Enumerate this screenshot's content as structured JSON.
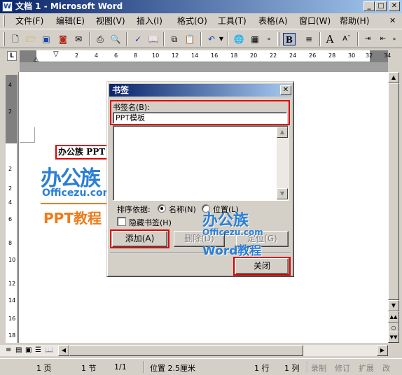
{
  "window": {
    "title": "文档 1 - Microsoft Word",
    "app_icon": "W",
    "controls": [
      "minimize-icon",
      "maximize-icon",
      "close-icon"
    ]
  },
  "menu": [
    "文件(F)",
    "编辑(E)",
    "视图(V)",
    "插入(I)",
    "格式(O)",
    "工具(T)",
    "表格(A)",
    "窗口(W)",
    "帮助(H)"
  ],
  "toolbar": {
    "bold_label": "B",
    "font_grow_label": "A",
    "icons": [
      "new-document-icon",
      "open-icon",
      "save-icon",
      "permission-icon",
      "email-icon",
      "print-icon",
      "print-preview-icon",
      "spelling-icon",
      "research-icon",
      "copy-icon",
      "paste-icon",
      "undo-icon",
      "hyperlink-icon",
      "table-icon",
      "align-icon"
    ]
  },
  "ruler": {
    "corner_label": "L",
    "h_ticks": [
      "2",
      "4",
      "6",
      "8",
      "10",
      "12",
      "14",
      "16",
      "18",
      "20",
      "22",
      "24",
      "26",
      "28",
      "30",
      "32",
      "34"
    ],
    "v_ticks": [
      "4",
      "2",
      "2",
      "2",
      "4",
      "6",
      "8",
      "10",
      "12",
      "14",
      "16",
      "18"
    ]
  },
  "document": {
    "text": "办公族 PPT"
  },
  "dialog": {
    "title": "书签",
    "name_label": "书签名(B):",
    "name_value": "PPT模板",
    "sort_label": "排序依据:",
    "sort_options": [
      {
        "label": "名称(N)",
        "selected": true
      },
      {
        "label": "位置(L)",
        "selected": false
      }
    ],
    "hidden_label": "隐藏书签(H)",
    "hidden_checked": false,
    "buttons": {
      "add": "添加(A)",
      "delete": "删除(D)",
      "goto": "定位(G)",
      "close": "关闭"
    }
  },
  "watermark": {
    "logo_cn": "办公族",
    "logo_en": "Officezu.com",
    "logo_sub": "Word教程",
    "doc_logo_cn": "办公族",
    "doc_logo_en": "Officezu.com",
    "doc_logo_sub": "PPT教程"
  },
  "status": {
    "page": "1 页",
    "section": "1 节",
    "pages": "1/1",
    "position": "位置 2.5厘米",
    "line": "1 行",
    "column": "1 列",
    "rec": "录制",
    "trk": "修订",
    "ext": "扩展",
    "ovr": "改"
  },
  "colors": {
    "highlight_box": "#e00000",
    "title_bar": "#0a246a",
    "logo_blue": "#2b7fd4",
    "logo_orange": "#f07a1a"
  }
}
